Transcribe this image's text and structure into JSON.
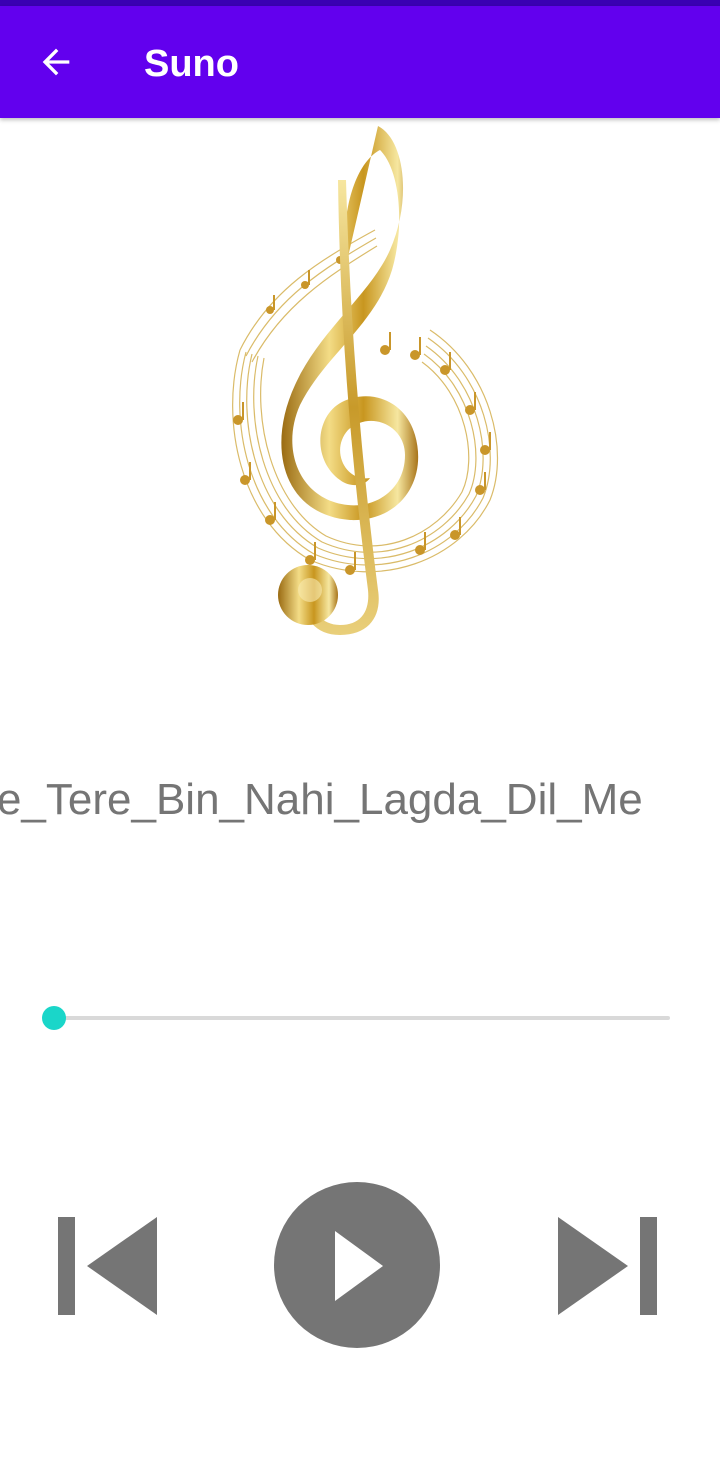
{
  "app_bar": {
    "title": "Suno",
    "back_icon": "arrow-back-icon",
    "background": "#6200ee"
  },
  "player": {
    "song_title": "Yaar_Rabba_Zindagi_Jee_Lene_De_Rube_Tere_Bin_Nahi_Lagda_Dil_Mera",
    "visible_song_title": "ube_Tere_Bin_Nahi_Lagda_Dil_Me",
    "artwork": "treble-clef-gold-artwork",
    "seek_progress": 0.0,
    "seek_color": "#1ad6c9",
    "controls": {
      "previous_icon": "skip-previous-icon",
      "play_icon": "play-icon",
      "next_icon": "skip-next-icon",
      "control_color": "#757575"
    }
  }
}
